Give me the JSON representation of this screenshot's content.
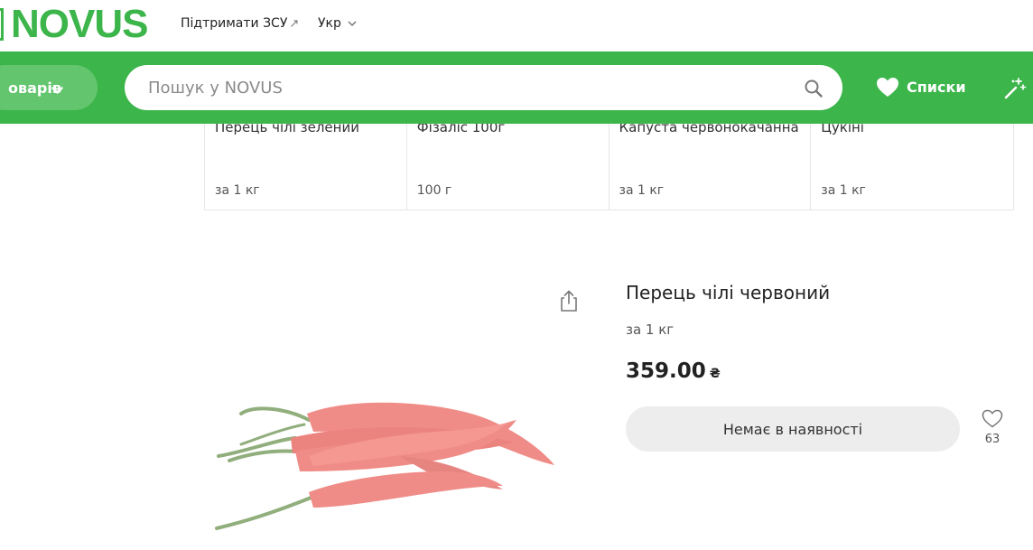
{
  "header": {
    "logo_text": "NOVUS",
    "support_link": "Підтримати ЗСУ",
    "language": "Укр",
    "catalog_label": "оварів",
    "search_placeholder": "Пошук у NOVUS",
    "lists_label": "Списки"
  },
  "related_products": [
    {
      "name": "Перець чілі зелений",
      "unit": "за 1 кг"
    },
    {
      "name": "Фізаліс 100г",
      "unit": "100 г"
    },
    {
      "name": "Капуста червонокачанна",
      "unit": "за 1 кг"
    },
    {
      "name": "Цукіні",
      "unit": "за 1 кг"
    }
  ],
  "product": {
    "title": "Перець чілі червоний",
    "unit": "за 1 кг",
    "price": "359.00",
    "currency": "₴",
    "availability_label": "Немає в наявності",
    "favorites_count": "63"
  },
  "colors": {
    "brand_green": "#3cb54a",
    "pepper_red": "#e8473e"
  },
  "icons": [
    "search-icon",
    "heart-icon",
    "sparkle-icon",
    "share-icon",
    "chevron-down-icon",
    "external-link-icon"
  ]
}
